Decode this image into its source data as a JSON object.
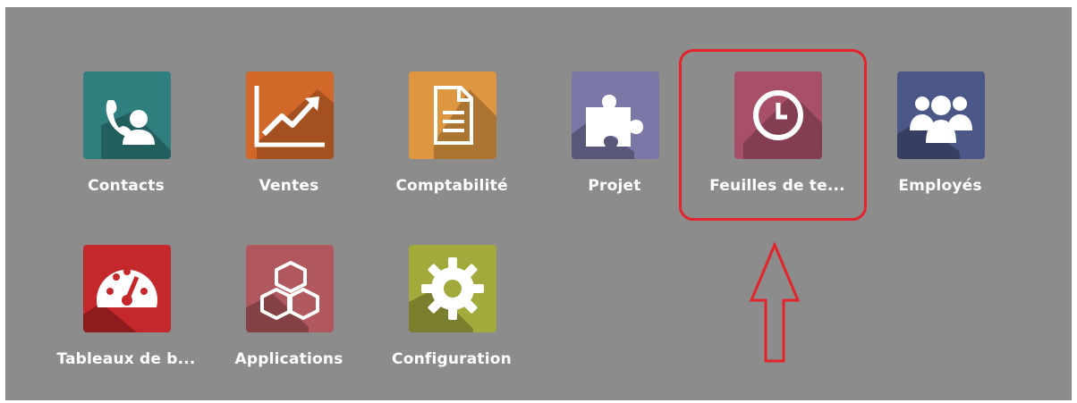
{
  "apps": [
    {
      "label": "Contacts",
      "icon": "contacts-icon",
      "color": "#2f7f7f"
    },
    {
      "label": "Ventes",
      "icon": "sales-chart-icon",
      "color": "#d2672a"
    },
    {
      "label": "Comptabilité",
      "icon": "document-icon",
      "color": "#de9640"
    },
    {
      "label": "Projet",
      "icon": "puzzle-icon",
      "color": "#7b78a8"
    },
    {
      "label": "Feuilles de te...",
      "icon": "clock-icon",
      "color": "#a85068"
    },
    {
      "label": "Employés",
      "icon": "employees-icon",
      "color": "#4b5787"
    },
    {
      "label": "Tableaux de b...",
      "icon": "dashboard-gauge-icon",
      "color": "#c5282c"
    },
    {
      "label": "Applications",
      "icon": "cubes-icon",
      "color": "#b0585e"
    },
    {
      "label": "Configuration",
      "icon": "gear-icon",
      "color": "#a3aa3c"
    }
  ],
  "annotation": {
    "highlight_color": "#e3242b",
    "target": "Feuilles de te..."
  }
}
